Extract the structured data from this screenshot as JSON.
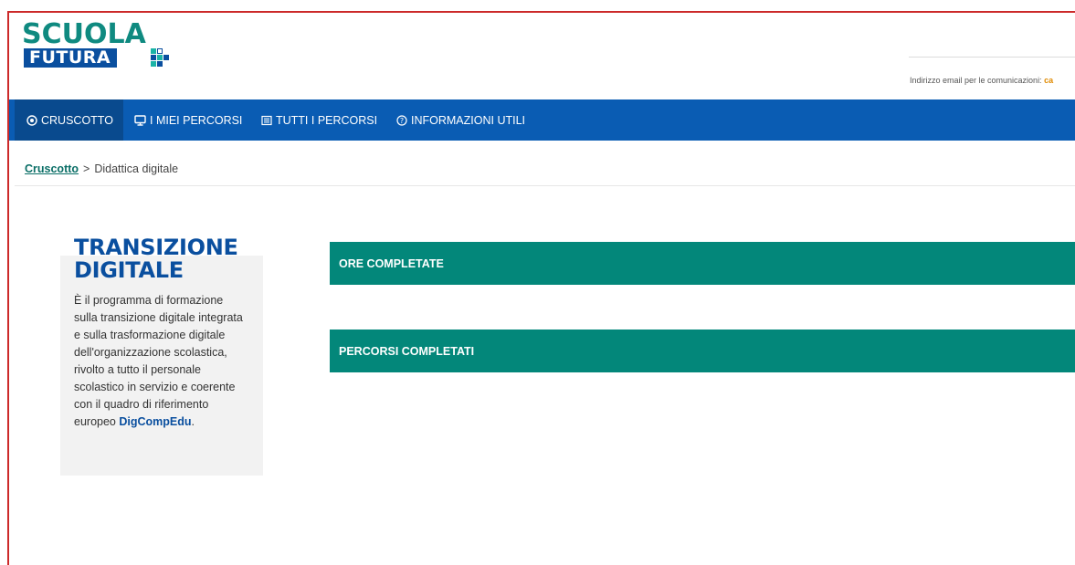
{
  "logo": {
    "line1": "SCUOLA",
    "line2": "FUTURA"
  },
  "header": {
    "email_label": "Indirizzo email per le comunicazioni:",
    "email_value_visible": "ca"
  },
  "nav": {
    "items": [
      {
        "label": "CRUSCOTTO",
        "icon": "target-icon",
        "active": true
      },
      {
        "label": "I MIEI PERCORSI",
        "icon": "monitor-icon",
        "active": false
      },
      {
        "label": "TUTTI I PERCORSI",
        "icon": "list-icon",
        "active": false
      },
      {
        "label": "INFORMAZIONI UTILI",
        "icon": "question-circle-icon",
        "active": false
      }
    ]
  },
  "breadcrumb": {
    "link": "Cruscotto",
    "separator": ">",
    "current": "Didattica digitale"
  },
  "info_card": {
    "title_line1": "TRANSIZIONE",
    "title_line2": "DIGITALE",
    "text": "È il programma di formazione sulla transizione digitale integrata e sulla trasformazione digitale dell'organizzazione scolastica, rivolto a tutto il personale scolastico in servizio e coerente con il quadro di riferimento europeo",
    "highlight": "DigCompEdu",
    "trailing": "."
  },
  "stats": {
    "hours_label": "ORE COMPLETATE",
    "paths_label": "PERCORSI COMPLETATI"
  },
  "colors": {
    "nav_bg": "#0a5cb3",
    "nav_active_bg": "#094a8e",
    "teal": "#03877a",
    "brand_blue": "#0a4f9f",
    "brand_teal": "#0f8a80",
    "frame_red": "#cc2a2a"
  }
}
